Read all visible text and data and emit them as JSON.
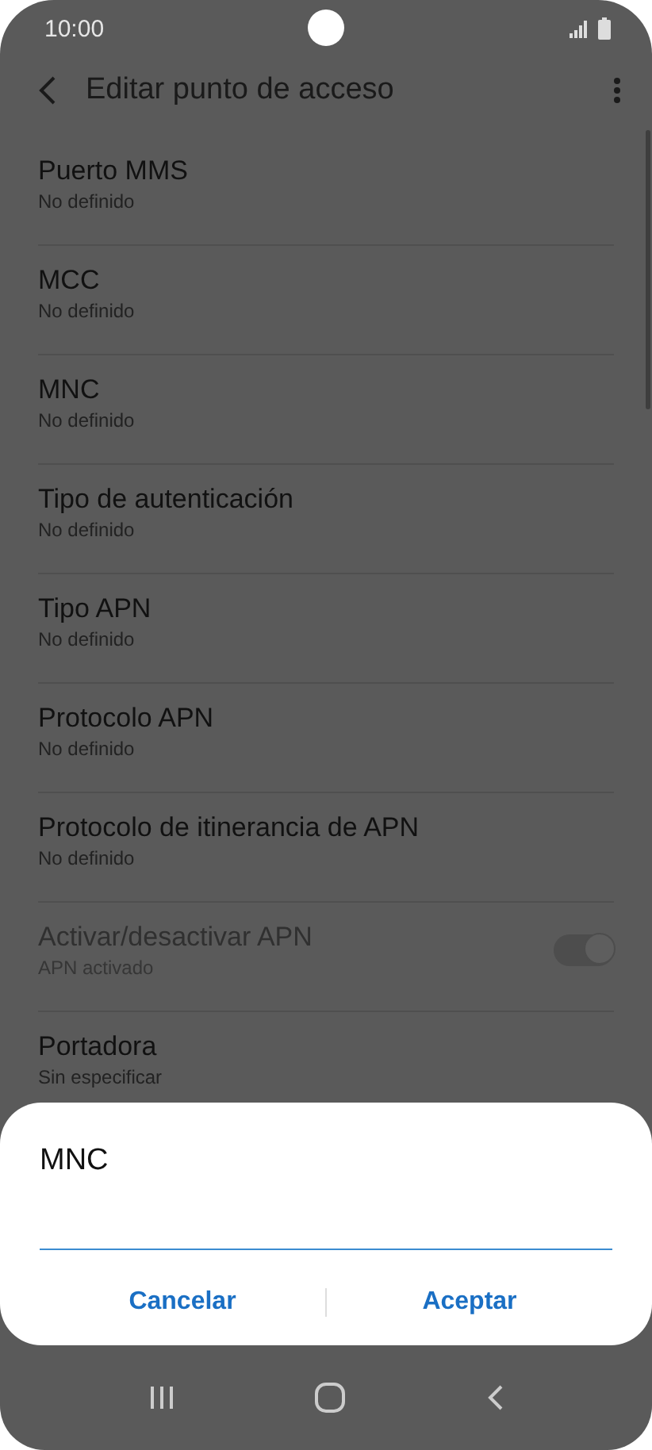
{
  "status_bar": {
    "time": "10:00"
  },
  "app_bar": {
    "title": "Editar punto de acceso"
  },
  "settings": [
    {
      "kind": "text",
      "title": "Puerto MMS",
      "value": "No definido",
      "disabled": false
    },
    {
      "kind": "text",
      "title": "MCC",
      "value": "No definido",
      "disabled": false
    },
    {
      "kind": "text",
      "title": "MNC",
      "value": "No definido",
      "disabled": false
    },
    {
      "kind": "text",
      "title": "Tipo de autenticación",
      "value": "No definido",
      "disabled": false
    },
    {
      "kind": "text",
      "title": "Tipo APN",
      "value": "No definido",
      "disabled": false
    },
    {
      "kind": "text",
      "title": "Protocolo APN",
      "value": "No definido",
      "disabled": false
    },
    {
      "kind": "text",
      "title": "Protocolo de itinerancia de APN",
      "value": "No definido",
      "disabled": false
    },
    {
      "kind": "switch",
      "title": "Activar/desactivar APN",
      "value": "APN activado",
      "disabled": true,
      "on": true
    },
    {
      "kind": "text",
      "title": "Portadora",
      "value": "Sin especificar",
      "disabled": false
    }
  ],
  "dialog": {
    "title": "MNC",
    "buttons": [
      "Cancelar",
      "Aceptar"
    ]
  }
}
